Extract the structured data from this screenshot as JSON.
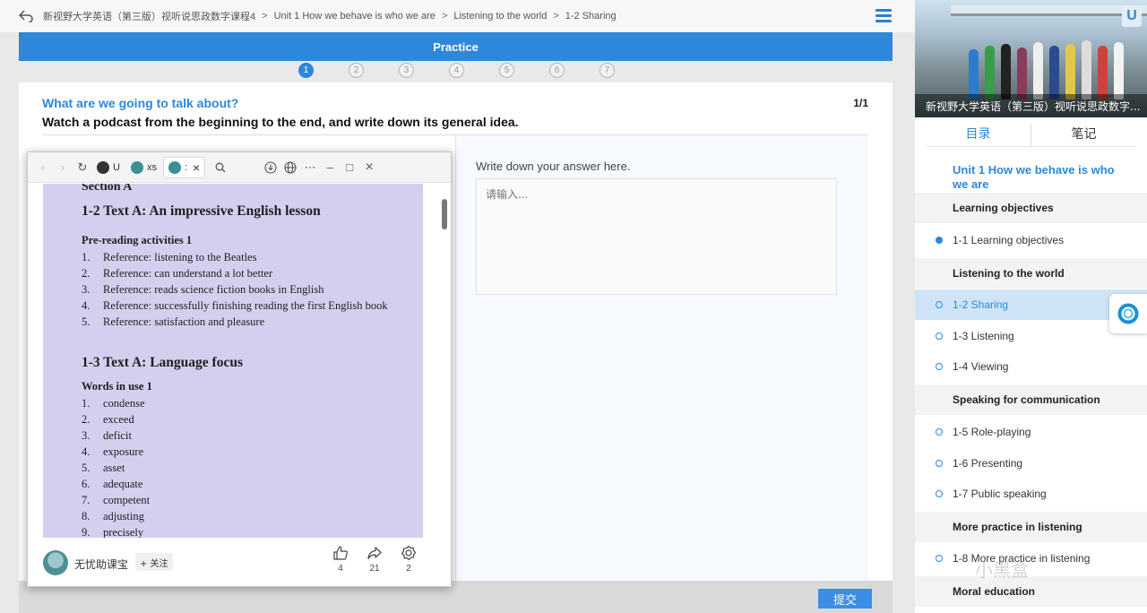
{
  "breadcrumb": [
    "新视野大学英语（第三版）视听说思政数字课程4",
    "Unit 1 How we behave is who we are",
    "Listening to the world",
    "1-2 Sharing"
  ],
  "practice_title": "Practice",
  "steps": [
    "1",
    "2",
    "3",
    "4",
    "5",
    "6",
    "7"
  ],
  "active_step": 1,
  "question": {
    "title": "What are we going to talk about?",
    "instruction": "Watch a podcast from the beginning to the end, and write down its general idea.",
    "count": "1/1",
    "answer_label": "Write down your answer here.",
    "answer_placeholder": "请输入..."
  },
  "submit_label": "提交",
  "popup": {
    "tabs": [
      {
        "label": "U",
        "icon": "github-icon"
      },
      {
        "label": "xs",
        "icon": "site-icon"
      },
      {
        "label": ":",
        "icon": "site-icon"
      }
    ],
    "doc": {
      "section": "Section A",
      "heading1": "1-2 Text A: An impressive English lesson",
      "sub1": "Pre-reading activities 1",
      "list1": [
        {
          "n": "1.",
          "t": "Reference: listening to the Beatles"
        },
        {
          "n": "2.",
          "t": "Reference: can understand a lot better"
        },
        {
          "n": "3.",
          "t": "Reference: reads science fiction books in English"
        },
        {
          "n": "4.",
          "t": "Reference: successfully finishing reading the first English book"
        },
        {
          "n": "5.",
          "t": "Reference: satisfaction and pleasure"
        }
      ],
      "heading2": "1-3 Text A: Language focus",
      "sub2": "Words in use 1",
      "list2": [
        {
          "n": "1.",
          "t": "condense"
        },
        {
          "n": "2.",
          "t": "exceed"
        },
        {
          "n": "3.",
          "t": "deficit"
        },
        {
          "n": "4.",
          "t": "exposure"
        },
        {
          "n": "5.",
          "t": "asset"
        },
        {
          "n": "6.",
          "t": "adequate"
        },
        {
          "n": "7.",
          "t": "competent"
        },
        {
          "n": "8.",
          "t": "adjusting"
        },
        {
          "n": "9.",
          "t": "precisely"
        }
      ]
    },
    "author": "无忧助课宝",
    "follow": "+ 关注",
    "likes": "4",
    "shares": "21",
    "collects": "2"
  },
  "sidebar": {
    "cover_title": "新视野大学英语（第三版）视听说思政数字...",
    "cover_badge": "U",
    "tabs": [
      "目录",
      "笔记"
    ],
    "unit_title": "Unit 1 How we behave is who we are",
    "entries": [
      {
        "type": "section",
        "label": "Learning objectives"
      },
      {
        "type": "item",
        "label": "1-1 Learning objectives",
        "state": "done"
      },
      {
        "type": "section",
        "label": "Listening to the world"
      },
      {
        "type": "item",
        "label": "1-2 Sharing",
        "state": "current"
      },
      {
        "type": "item",
        "label": "1-3 Listening",
        "state": "todo"
      },
      {
        "type": "item",
        "label": "1-4 Viewing",
        "state": "todo"
      },
      {
        "type": "section",
        "label": "Speaking for communication"
      },
      {
        "type": "item",
        "label": "1-5 Role-playing",
        "state": "todo"
      },
      {
        "type": "item",
        "label": "1-6 Presenting",
        "state": "todo"
      },
      {
        "type": "item",
        "label": "1-7 Public speaking",
        "state": "todo"
      },
      {
        "type": "section",
        "label": "More practice in listening"
      },
      {
        "type": "item",
        "label": "1-8 More practice in listening",
        "state": "todo"
      },
      {
        "type": "section",
        "label": "Moral education"
      }
    ]
  },
  "watermark": "小黑盒",
  "colors": {
    "accent": "#2d88d9",
    "doc_bg": "#d3d0ef",
    "submit": "#3a8ee6"
  }
}
